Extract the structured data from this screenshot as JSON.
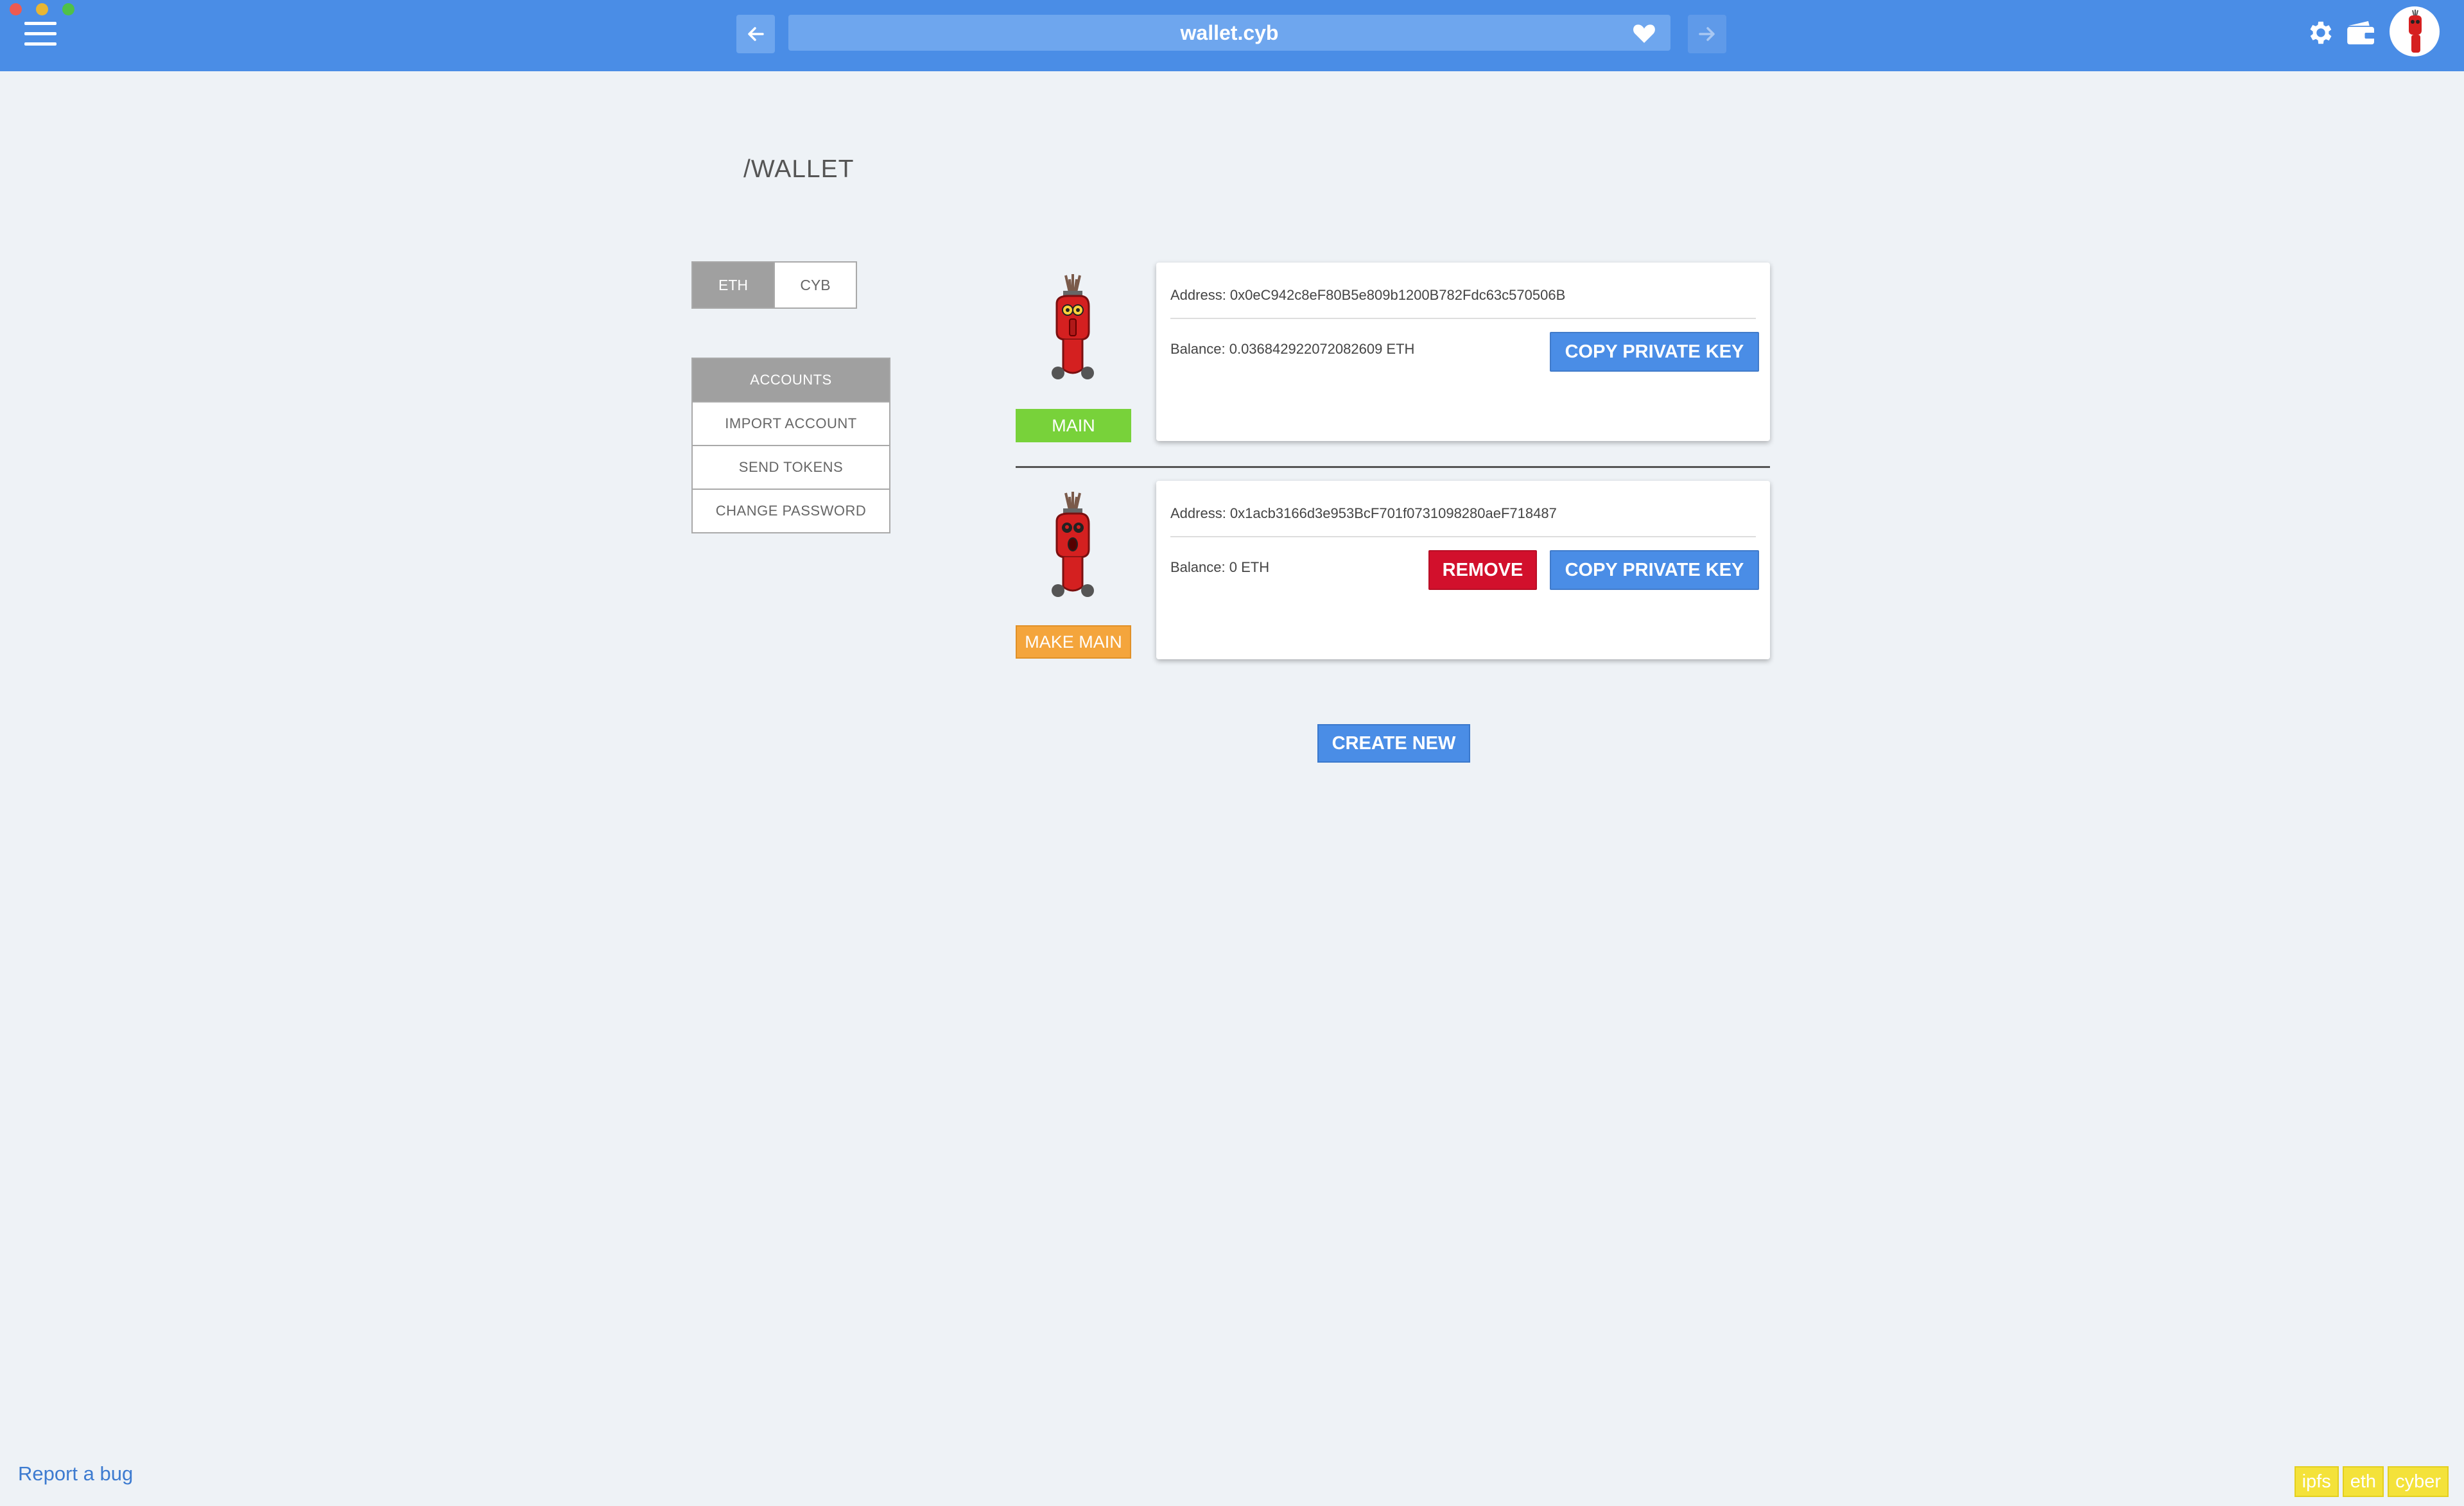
{
  "browser": {
    "url": "wallet.cyb",
    "back_icon": "arrow-left-icon",
    "forward_icon": "arrow-right-icon",
    "favorite_icon": "heart-icon",
    "settings_icon": "gear-icon",
    "wallet_icon": "wallet-icon",
    "menu_icon": "hamburger-icon"
  },
  "page": {
    "title": "/WALLET"
  },
  "network_tabs": [
    {
      "label": "ETH",
      "active": true
    },
    {
      "label": "CYB",
      "active": false
    }
  ],
  "sidebar": {
    "items": [
      {
        "label": "ACCOUNTS",
        "active": true
      },
      {
        "label": "IMPORT ACCOUNT",
        "active": false
      },
      {
        "label": "SEND TOKENS",
        "active": false
      },
      {
        "label": "CHANGE PASSWORD",
        "active": false
      }
    ]
  },
  "accounts": [
    {
      "address": "Address: 0x0eC942c8eF80B5e809b1200B782Fdc63c570506B",
      "balance": "Balance: 0.036842922072082609 ETH",
      "status_label": "MAIN",
      "copy_label": "COPY PRIVATE KEY"
    },
    {
      "address": "Address: 0x1acb3166d3e953BcF701f0731098280aeF718487",
      "balance": "Balance: 0 ETH",
      "status_label": "MAKE MAIN",
      "remove_label": "REMOVE",
      "copy_label": "COPY PRIVATE KEY"
    }
  ],
  "actions": {
    "create_new": "CREATE NEW"
  },
  "footer": {
    "report_bug": "Report a bug",
    "badges": [
      "ipfs",
      "eth",
      "cyber"
    ]
  },
  "colors": {
    "topbar": "#4a8de6",
    "main_button": "#78d23a",
    "make_main_button": "#f4a53c",
    "remove_button": "#d2102c",
    "primary_button": "#4a8de6",
    "badge": "#f4e23a"
  }
}
